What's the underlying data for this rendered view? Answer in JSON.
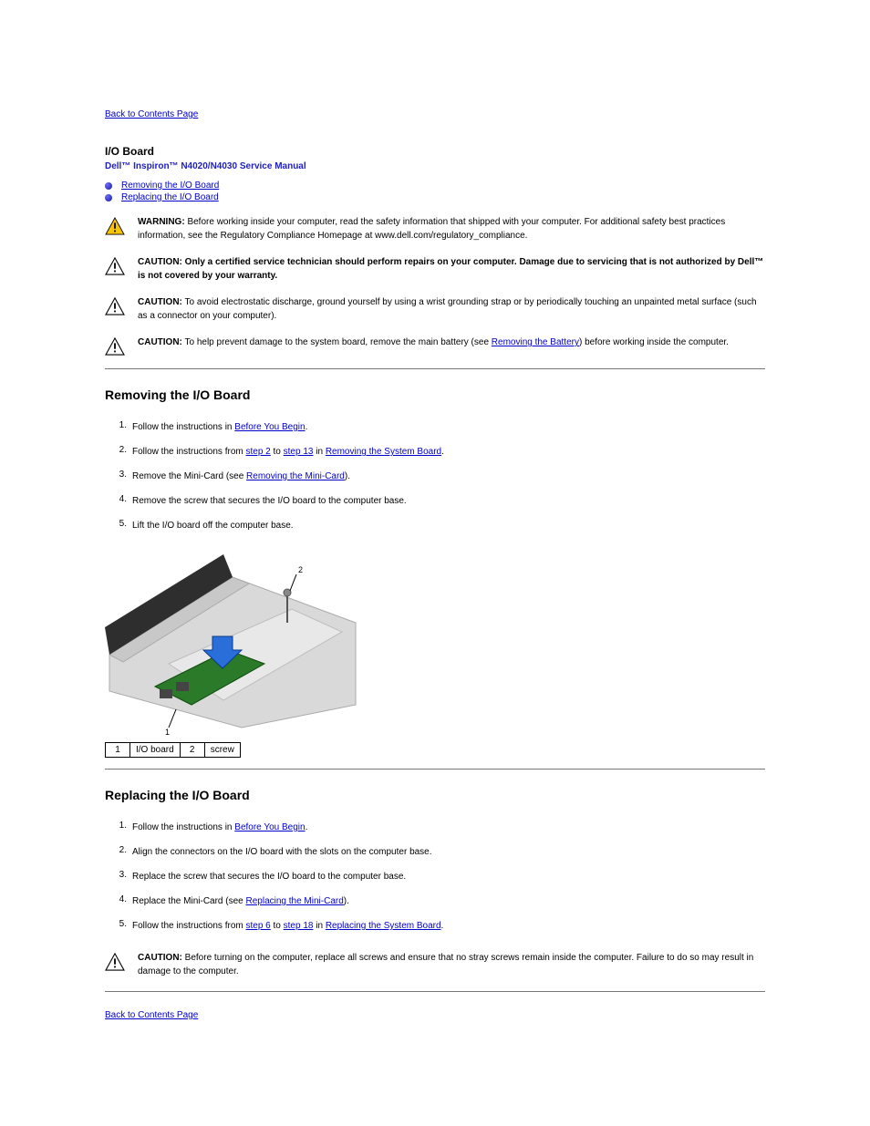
{
  "nav": {
    "back_top": "Back to Contents Page",
    "back_bottom": "Back to Contents Page"
  },
  "title": "I/O Board",
  "manual": "Dell™ Inspiron™ N4020/N4030 Service Manual",
  "toc": {
    "items": [
      {
        "label": "Removing the I/O Board"
      },
      {
        "label": "Replacing the I/O Board"
      }
    ]
  },
  "notices": {
    "warning": {
      "label": "WARNING:",
      "text": "Before working inside your computer, read the safety information that shipped with your computer. For additional safety best practices information, see the Regulatory Compliance Homepage at www.dell.com/regulatory_compliance."
    },
    "caution_auth": {
      "label": "CAUTION:",
      "lead": "Only a certified service technician should perform repairs on your computer. Damage due to servicing that is not authorized by Dell™",
      "tail": "is not covered by your warranty."
    },
    "caution_esd": {
      "label": "CAUTION:",
      "text": "To avoid electrostatic discharge, ground yourself by using a wrist grounding strap or by periodically touching an unpainted metal surface (such as a connector on your computer)."
    },
    "caution_batt": {
      "label": "CAUTION:",
      "text_pre": "To help prevent damage to the system board, remove the main battery (see ",
      "link": "Removing the Battery",
      "text_post": ") before working inside the computer."
    },
    "caution_on": {
      "label": "CAUTION:",
      "text": "Before turning on the computer, replace all screws and ensure that no stray screws remain inside the computer. Failure to do so may result in damage to the computer."
    }
  },
  "remove": {
    "heading": "Removing the I/O Board",
    "steps": [
      {
        "n": "1.",
        "text_pre": "Follow the instructions in ",
        "link": "Before You Begin",
        "text_post": "."
      },
      {
        "n": "2.",
        "text_pre": "Follow the instructions from ",
        "link1": "step 2",
        "mid1": " to ",
        "link2": "step 13",
        "mid2": " in ",
        "link3": "Removing the System Board",
        "text_post": "."
      },
      {
        "n": "3.",
        "text_pre": "Remove the Mini-Card (see ",
        "link": "Removing the Mini-Card",
        "text_post": ")."
      },
      {
        "n": "4.",
        "plain": "Remove the screw that secures the I/O board to the computer base."
      },
      {
        "n": "5.",
        "plain": "Lift the I/O board off the computer base."
      }
    ]
  },
  "callouts": {
    "c1": {
      "n": "1",
      "label": "I/O board"
    },
    "c2": {
      "n": "2",
      "label": "screw"
    }
  },
  "replace": {
    "heading": "Replacing the I/O Board",
    "steps": [
      {
        "n": "1.",
        "text_pre": "Follow the instructions in ",
        "link": "Before You Begin",
        "text_post": "."
      },
      {
        "n": "2.",
        "plain": "Align the connectors on the I/O board with the slots on the computer base."
      },
      {
        "n": "3.",
        "plain": "Replace the screw that secures the I/O board to the computer base."
      },
      {
        "n": "4.",
        "text_pre": "Replace the Mini-Card (see ",
        "link": "Replacing the Mini-Card",
        "text_post": ")."
      },
      {
        "n": "5.",
        "text_pre": "Follow the instructions from ",
        "link1": "step 6",
        "mid1": " to ",
        "link2": "step 18",
        "mid2": " in ",
        "link3": "Replacing the System Board",
        "text_post": "."
      }
    ]
  }
}
